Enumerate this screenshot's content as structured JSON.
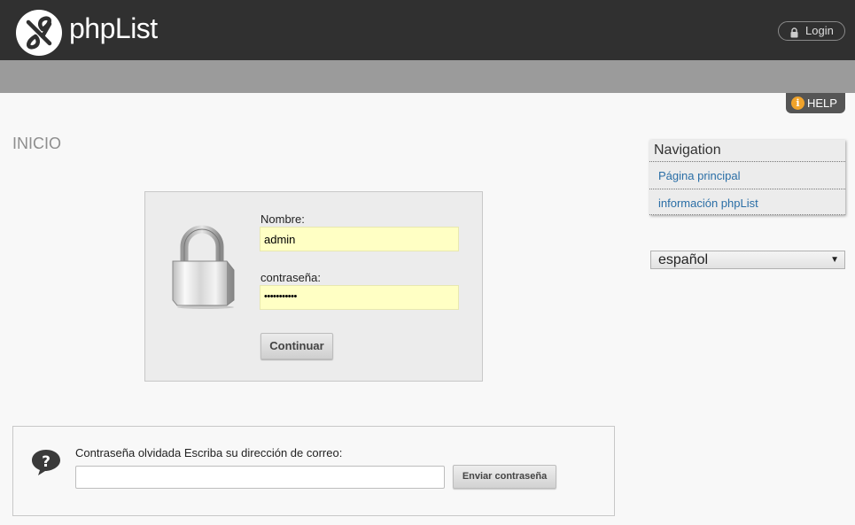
{
  "header": {
    "brand": "phpList",
    "login_label": "Login"
  },
  "help": {
    "label": "HELP"
  },
  "page": {
    "title": "INICIO"
  },
  "login_form": {
    "name_label": "Nombre:",
    "name_value": "admin",
    "password_label": "contraseña:",
    "password_value": "•••••••••••",
    "submit_label": "Continuar"
  },
  "forgot": {
    "label": "Contraseña olvidada Escriba su dirección de correo:",
    "email_value": "",
    "submit_label": "Enviar contraseña"
  },
  "navigation": {
    "title": "Navigation",
    "items": [
      {
        "label": "Página principal"
      },
      {
        "label": "información phpList"
      }
    ]
  },
  "language": {
    "selected": "español"
  },
  "colors": {
    "topbar": "#303030",
    "subbar": "#9b9b9b",
    "field_highlight": "#ffffc4",
    "link": "#2a6ea6",
    "help_icon": "#f0a32b"
  },
  "icons": {
    "logo": "phplist-logo-icon",
    "login": "lock-icon",
    "help": "info-icon",
    "padlock": "padlock-icon",
    "question": "question-bubble-icon",
    "dropdown": "chevron-down-icon"
  }
}
